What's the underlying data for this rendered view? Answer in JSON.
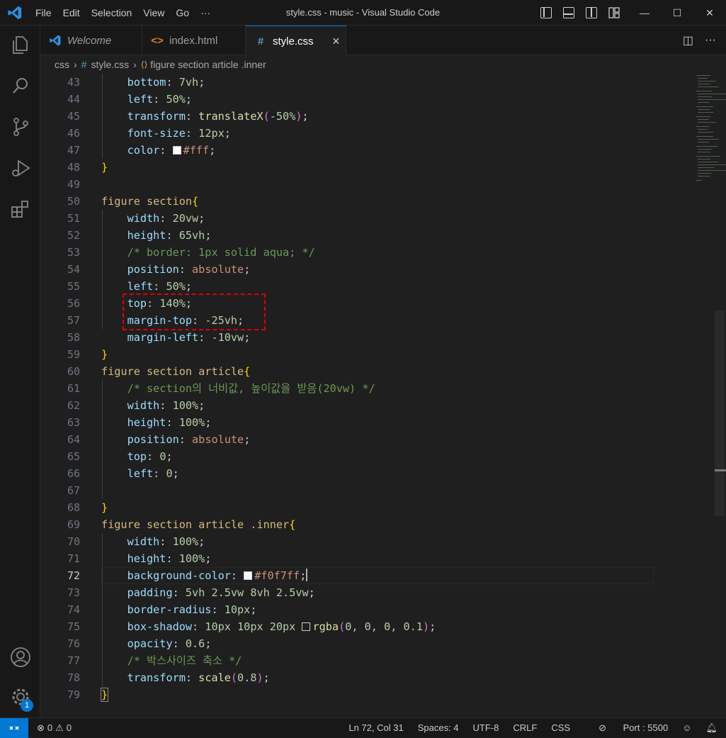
{
  "window": {
    "title": "style.css - music - Visual Studio Code"
  },
  "menu": [
    "File",
    "Edit",
    "Selection",
    "View",
    "Go",
    "···"
  ],
  "window_controls": {
    "minimize": "—",
    "maximize": "☐",
    "close": "✕"
  },
  "tabs": [
    {
      "label": "Welcome",
      "icon": "vscode-icon",
      "active": false
    },
    {
      "label": "index.html",
      "icon": "html-icon",
      "active": false
    },
    {
      "label": "style.css",
      "icon": "css-hash-icon",
      "active": true
    }
  ],
  "tab_close": "✕",
  "tab_actions": {
    "split": "◫",
    "more": "···"
  },
  "breadcrumb": [
    "css",
    "style.css",
    "figure section article .inner"
  ],
  "breadcrumb_icons": {
    "hash": "#",
    "symbol": "⟨⟩"
  },
  "editor": {
    "active_line": 72,
    "line_numbers": [
      "43",
      "44",
      "45",
      "46",
      "47",
      "48",
      "49",
      "50",
      "51",
      "52",
      "53",
      "54",
      "55",
      "56",
      "57",
      "58",
      "59",
      "60",
      "61",
      "62",
      "63",
      "64",
      "65",
      "66",
      "67",
      "68",
      "69",
      "70",
      "71",
      "72",
      "73",
      "74",
      "75",
      "76",
      "77",
      "78",
      "79"
    ],
    "text": {
      "l43_prop": "bottom",
      "l43_val": "7vh",
      "l44_prop": "left",
      "l44_val": "50%",
      "l45_prop": "transform",
      "l45_fn": "translateX",
      "l45_val": "-50%",
      "l46_prop": "font-size",
      "l46_val": "12px",
      "l47_prop": "color",
      "l47_val": "#fff",
      "brace_close": "}",
      "l50_sel": "figure section",
      "brace_open": "{",
      "l51_prop": "width",
      "l51_val": "20vw",
      "l52_prop": "height",
      "l52_val": "65vh",
      "l53_comment": "/* border: 1px solid aqua; */",
      "l54_prop": "position",
      "l54_val": "absolute",
      "l55_prop": "left",
      "l55_val": "50%",
      "l56_prop": "top",
      "l56_val": "140%",
      "l57_prop": "margin-top",
      "l57_val": "-25vh",
      "l58_prop": "margin-left",
      "l58_val": "-10vw",
      "l60_sel": "figure section article",
      "l61_comment": "/* section의 너비값, 높이값을 받음(20vw) */",
      "l62_prop": "width",
      "l62_val": "100%",
      "l63_prop": "height",
      "l63_val": "100%",
      "l64_prop": "position",
      "l64_val": "absolute",
      "l65_prop": "top",
      "l65_val": "0",
      "l66_prop": "left",
      "l66_val": "0",
      "l69_sel": "figure section article .inner",
      "l70_prop": "width",
      "l70_val": "100%",
      "l71_prop": "height",
      "l71_val": "100%",
      "l72_prop": "background-color",
      "l72_val": "#f0f7ff",
      "l73_prop": "padding",
      "l73_val": "5vh 2.5vw 8vh 2.5vw",
      "l74_prop": "border-radius",
      "l74_val": "10px",
      "l75_prop": "box-shadow",
      "l75_pre": "10px 10px 20px",
      "l75_fn": "rgba",
      "l75_args": "0, 0, 0, 0.1",
      "l76_prop": "opacity",
      "l76_val": "0.6",
      "l77_comment": "/* 박스사이즈 축소 */",
      "l78_prop": "transform",
      "l78_fn": "scale",
      "l78_val": "0.8"
    }
  },
  "status": {
    "errors": "0",
    "warnings": "0",
    "position": "Ln 72, Col 31",
    "spaces": "Spaces: 4",
    "encoding": "UTF-8",
    "eol": "CRLF",
    "language": "CSS",
    "port": "Port : 5500"
  },
  "accounts_badge": "1",
  "colors": {
    "accent": "#0078d4",
    "highlight_box": "#e00000"
  }
}
